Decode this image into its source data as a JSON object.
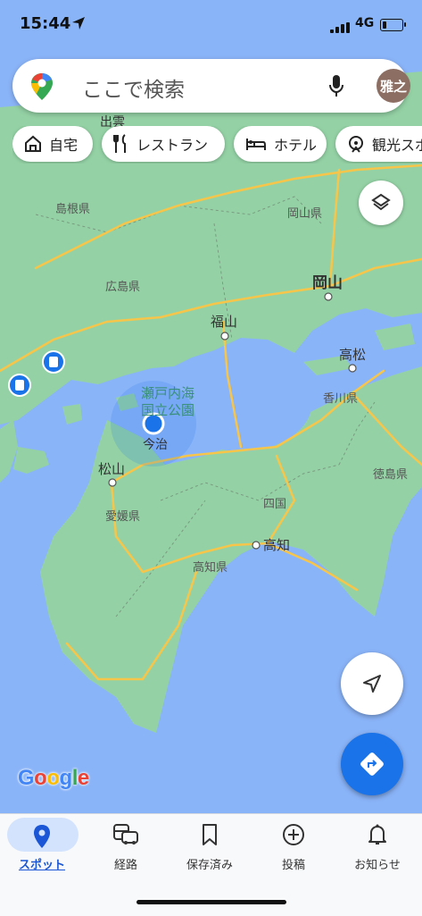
{
  "status_bar": {
    "time": "15:44",
    "network": "4G",
    "battery_level": 0.2
  },
  "search": {
    "placeholder": "ここで検索",
    "avatar_text": "雅之"
  },
  "chips": [
    {
      "label": "自宅",
      "icon": "home-icon"
    },
    {
      "label": "レストラン",
      "icon": "restaurant-icon"
    },
    {
      "label": "ホテル",
      "icon": "hotel-icon"
    },
    {
      "label": "観光スポ",
      "icon": "attraction-icon"
    }
  ],
  "map": {
    "labels": {
      "izumo": "出雲",
      "shimane": "島根県",
      "okayama_pref": "岡山県",
      "hiroshima": "広島県",
      "okayama": "岡山",
      "fukuyama": "福山",
      "takamatsu": "高松",
      "kagawa": "香川県",
      "setonaikai": "瀬戸内海",
      "park": "国立公園",
      "imabari": "今治",
      "matsuyama": "松山",
      "tokushima": "徳島県",
      "ehime": "愛媛県",
      "shikoku": "四国",
      "kochi": "高知",
      "kochi_pref": "高知県"
    },
    "colors": {
      "water": "#8ab4f8",
      "land": "#94d2a5",
      "road": "#f6c54a",
      "location": "#1a73e8"
    }
  },
  "brand": {
    "google": [
      "G",
      "o",
      "o",
      "g",
      "l",
      "e"
    ]
  },
  "bottom_nav": [
    {
      "label": "スポット",
      "icon": "location-pin-icon",
      "active": true
    },
    {
      "label": "経路",
      "icon": "commute-icon",
      "active": false
    },
    {
      "label": "保存済み",
      "icon": "bookmark-icon",
      "active": false
    },
    {
      "label": "投稿",
      "icon": "add-circle-icon",
      "active": false
    },
    {
      "label": "お知らせ",
      "icon": "bell-icon",
      "active": false
    }
  ]
}
